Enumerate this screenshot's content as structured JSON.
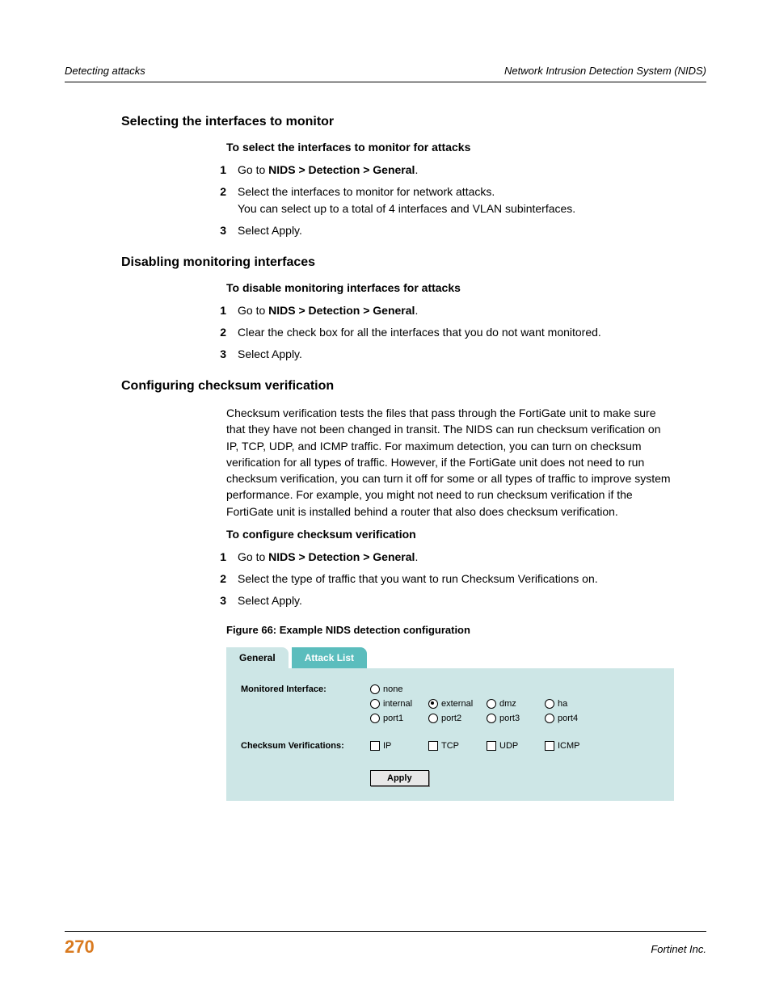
{
  "header": {
    "left": "Detecting attacks",
    "right": "Network Intrusion Detection System (NIDS)"
  },
  "s1": {
    "heading": "Selecting the interfaces to monitor",
    "sub": "To select the interfaces to monitor for attacks",
    "step1_a": "Go to ",
    "step1_b": "NIDS > Detection > General",
    "step1_c": ".",
    "step2_a": "Select the interfaces to monitor for network attacks.",
    "step2_b": "You can select up to a total of 4 interfaces and VLAN subinterfaces.",
    "step3": "Select Apply."
  },
  "s2": {
    "heading": "Disabling monitoring interfaces",
    "sub": "To disable monitoring interfaces for attacks",
    "step1_a": "Go to ",
    "step1_b": "NIDS > Detection > General",
    "step1_c": ".",
    "step2": "Clear the check box for all the interfaces that you do not want monitored.",
    "step3": "Select Apply."
  },
  "s3": {
    "heading": "Configuring checksum verification",
    "para": "Checksum verification tests the files that pass through the FortiGate unit to make sure that they have not been changed in transit. The NIDS can run checksum verification on IP, TCP, UDP, and ICMP traffic. For maximum detection, you can turn on checksum verification for all types of traffic. However, if the FortiGate unit does not need to run checksum verification, you can turn it off for some or all types of traffic to improve system performance. For example, you might not need to run checksum verification if the FortiGate unit is installed behind a router that also does checksum verification.",
    "sub": "To configure checksum verification",
    "step1_a": "Go to ",
    "step1_b": "NIDS > Detection > General",
    "step1_c": ".",
    "step2": "Select the type of traffic that you want to run Checksum Verifications on.",
    "step3": "Select Apply."
  },
  "figure": {
    "caption": "Figure 66: Example NIDS detection configuration",
    "tab_general": "General",
    "tab_attack": "Attack List",
    "label_monitored": "Monitored Interface:",
    "label_checksum": "Checksum Verifications:",
    "opt_none": "none",
    "opt_internal": "internal",
    "opt_external": "external",
    "opt_dmz": "dmz",
    "opt_ha": "ha",
    "opt_port1": "port1",
    "opt_port2": "port2",
    "opt_port3": "port3",
    "opt_port4": "port4",
    "ck_ip": "IP",
    "ck_tcp": "TCP",
    "ck_udp": "UDP",
    "ck_icmp": "ICMP",
    "apply": "Apply"
  },
  "footer": {
    "page": "270",
    "company": "Fortinet Inc."
  },
  "nums": {
    "n1": "1",
    "n2": "2",
    "n3": "3"
  }
}
